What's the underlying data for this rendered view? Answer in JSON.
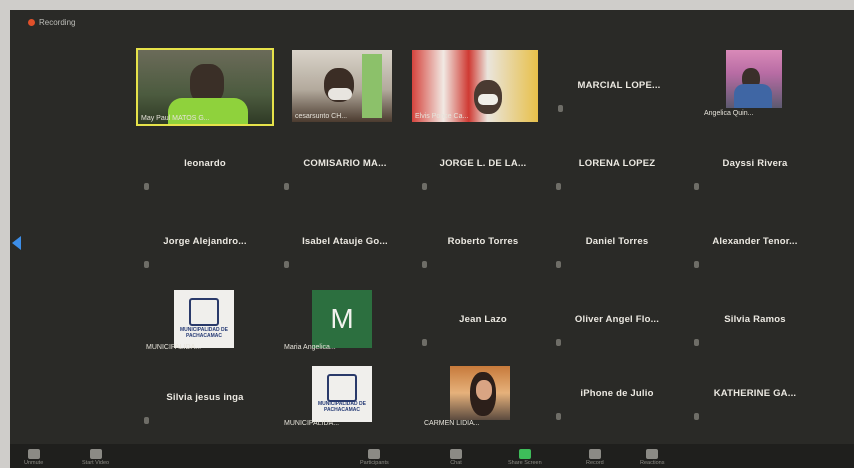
{
  "recording": {
    "label": "Recording"
  },
  "grid": {
    "row1": {
      "marcial": "MARCIAL LOPE..."
    },
    "videos": {
      "v1": "May Paul MATOS G...",
      "v2": "cesarsunto CH...",
      "v3": "Elvis Ponce Ca...",
      "v4": "Angelica Quin..."
    },
    "row2": [
      "leonardo",
      "COMISARIO MA...",
      "JORGE L. DE LA...",
      "LORENA LOPEZ",
      "Dayssi Rivera"
    ],
    "row3": [
      "Jorge Alejandro...",
      "Isabel Atauje Go...",
      "Roberto Torres",
      "Daniel Torres",
      "Alexander Tenor..."
    ],
    "row4": {
      "logo_label": "MUNICIPALIDA...",
      "m_letter": "M",
      "m_label": "Maria Angelica...",
      "names": [
        "Jean Lazo",
        "Oliver Angel Flo...",
        "Silvia Ramos"
      ]
    },
    "row5": {
      "first": "Silvia jesus inga",
      "logo_label": "MUNICIPALIDA...",
      "carmen_label": "CARMEN LIDIA...",
      "names": [
        "iPhone de Julio",
        "KATHERINE GA..."
      ]
    },
    "logo_text": "MUNICIPALIDAD DE PACHACAMAC"
  },
  "toolbar": {
    "unmute": "Unmute",
    "start_video": "Start Video",
    "participants": "Participants",
    "chat": "Chat",
    "share_screen": "Share Screen",
    "record": "Record",
    "reactions": "Reactions"
  }
}
